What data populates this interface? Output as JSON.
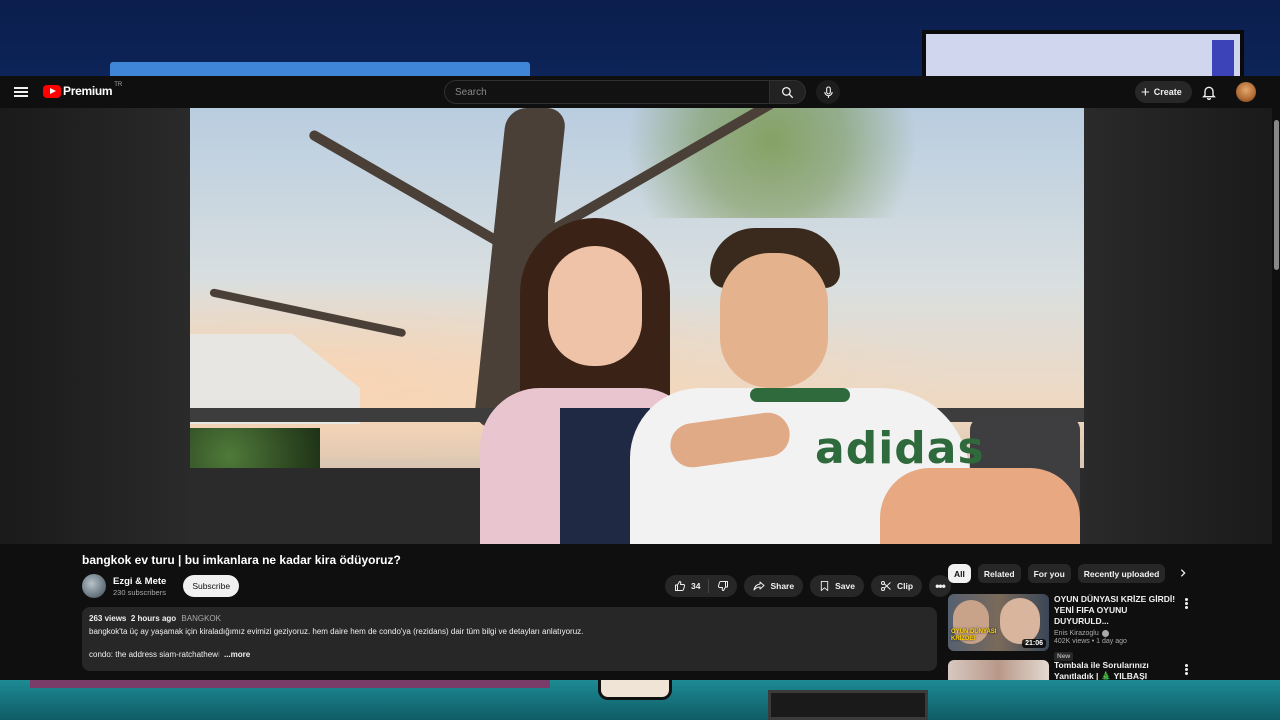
{
  "header": {
    "logo_text": "Premium",
    "logo_country": "TR",
    "search_placeholder": "Search",
    "create_label": "Create"
  },
  "video": {
    "title": "bangkok ev turu | bu imkanlara ne kadar kira ödüyoruz?",
    "channel_name": "Ezgi & Mete",
    "subscribers": "230 subscribers",
    "subscribe_label": "Subscribe",
    "shirt_text": "adidas"
  },
  "actions": {
    "likes": "34",
    "share_label": "Share",
    "save_label": "Save",
    "clip_label": "Clip"
  },
  "description": {
    "views": "263 views",
    "time": "2 hours ago",
    "location": "BANGKOK",
    "line1": "bangkok'ta üç ay yaşamak için kiraladığımız evimizi geziyoruz. hem daire hem de condo'ya (rezidans) dair tüm bilgi ve detayları anlatıyoruz.",
    "line2": "condo: the address siam-ratchathew",
    "line2_fade": "i",
    "more_label": "...more"
  },
  "chips": [
    "All",
    "Related",
    "For you",
    "Recently uploaded"
  ],
  "recommendations": [
    {
      "title": "OYUN DÜNYASI KRİZE GİRDİ! YENİ FIFA OYUNU DUYURULD...",
      "channel": "Enis Kirazoglu",
      "stats": "402K views • 1 day ago",
      "badge": "New",
      "duration": "21:06",
      "thumb_text": "OYUN DÜNYASI KRİZDE!"
    },
    {
      "title": "Tombala ile Sorularınızı Yanıtladık | 🎄 YILBAŞI ÖZEL..."
    }
  ],
  "colors": {
    "brand": "#ff0000",
    "background": "#0f0f0f",
    "pill": "#272727"
  }
}
